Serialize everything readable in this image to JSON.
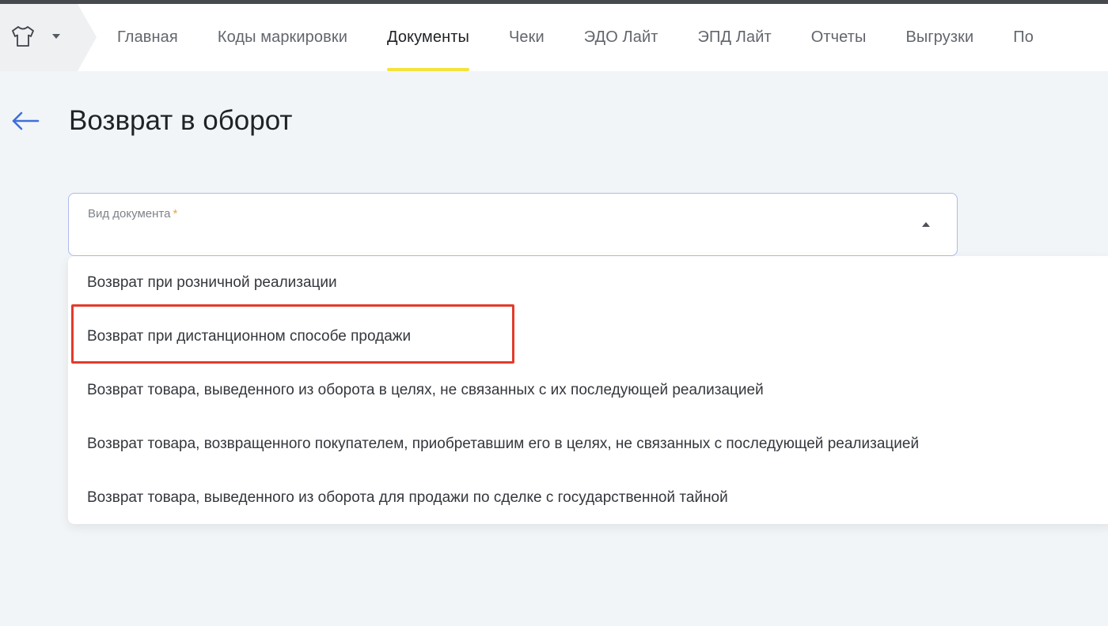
{
  "nav": {
    "items": [
      "Главная",
      "Коды маркировки",
      "Документы",
      "Чеки",
      "ЭДО Лайт",
      "ЭПД Лайт",
      "Отчеты",
      "Выгрузки",
      "По"
    ],
    "active_index": 2
  },
  "icons": {
    "product": "tshirt-icon",
    "product_caret": "caret-down-icon",
    "back": "arrow-left-icon",
    "select_caret": "caret-up-icon"
  },
  "page": {
    "title": "Возврат в оборот"
  },
  "document_type": {
    "label": "Вид документа",
    "required_mark": "*",
    "value": "",
    "options": [
      "Возврат при розничной реализации",
      "Возврат при дистанционном способе продажи",
      "Возврат товара, выведенного из оборота в целях, не связанных с их последующей реализацией",
      "Возврат товара, возвращенного покупателем, приобретавшим его в целях, не связанных с последующей реализацией",
      "Возврат товара, выведенного из оборота для продажи по сделке с государственной тайной"
    ],
    "highlighted_index": 1
  },
  "colors": {
    "accent_yellow": "#f4e33a",
    "back_arrow_blue": "#3f6fd8",
    "required_orange": "#f2a33a",
    "highlight_red": "#e23b2b",
    "select_border": "#aeb9ee"
  }
}
